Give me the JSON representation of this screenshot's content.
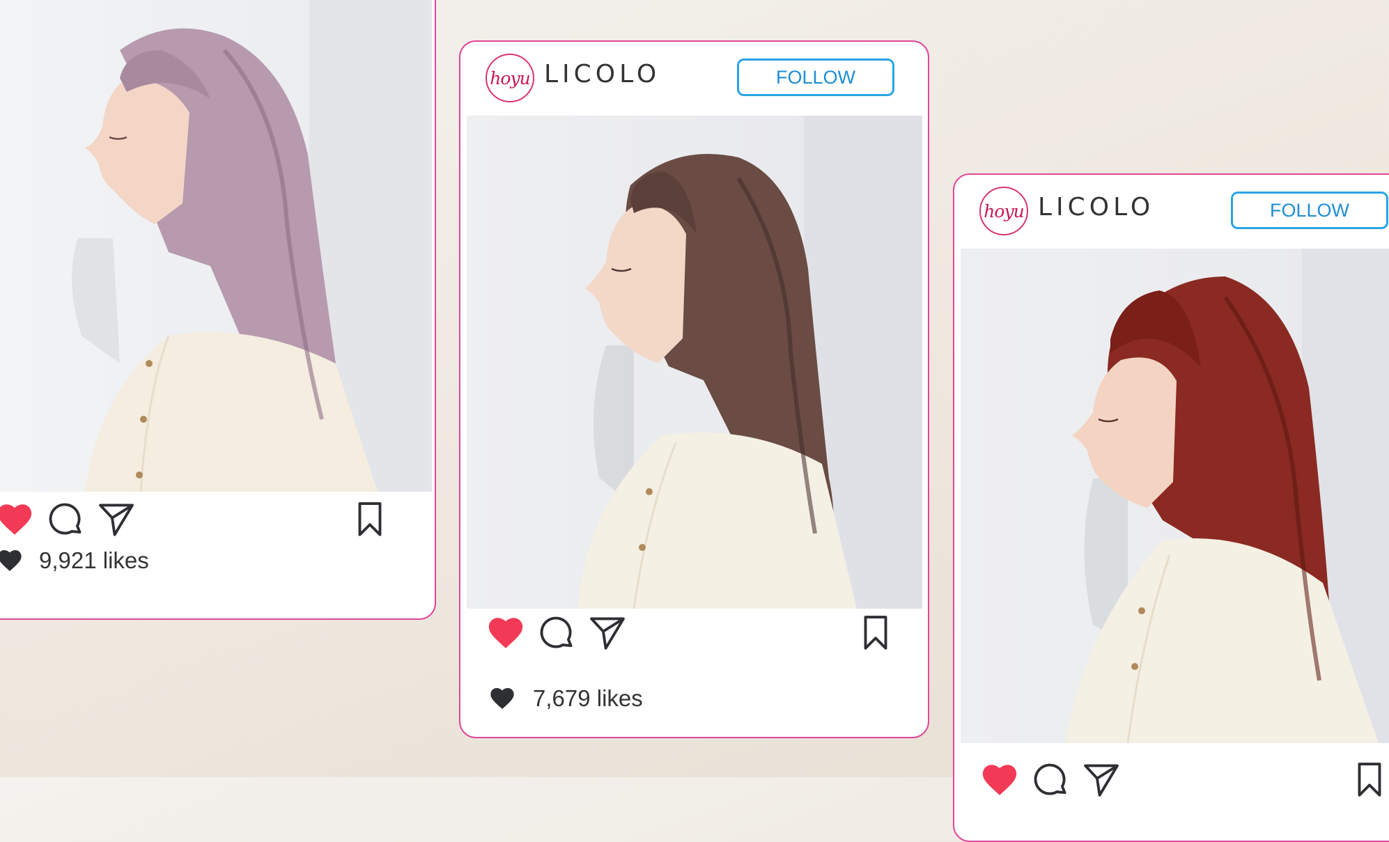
{
  "colors": {
    "card_border": "#e0479a",
    "follow_blue": "#29a4e6",
    "like_red": "#f23a57",
    "icon_dark": "#2e2f33",
    "logo_red": "#c7184f"
  },
  "posts": [
    {
      "hair_color": "#b79aad",
      "hair_shadow": "#8d7085",
      "likes_text": "9,921 likes",
      "icons": [
        "heart-filled-icon",
        "comment-icon",
        "send-icon",
        "bookmark-icon",
        "heart-dark-icon"
      ]
    },
    {
      "logo_text": "hoyu",
      "brand_text": "LICOLO",
      "follow_label": "FOLLOW",
      "hair_color": "#6a4c45",
      "hair_shadow": "#3f2b27",
      "likes_text": "7,679 likes",
      "icons": [
        "heart-filled-icon",
        "comment-icon",
        "send-icon",
        "bookmark-icon",
        "heart-dark-icon"
      ]
    },
    {
      "logo_text": "hoyu",
      "brand_text": "LICOLO",
      "follow_label": "FOLLOW",
      "hair_color": "#8a2a22",
      "hair_shadow": "#5a1511",
      "icons": [
        "heart-filled-icon",
        "comment-icon",
        "send-icon",
        "bookmark-icon"
      ]
    }
  ]
}
